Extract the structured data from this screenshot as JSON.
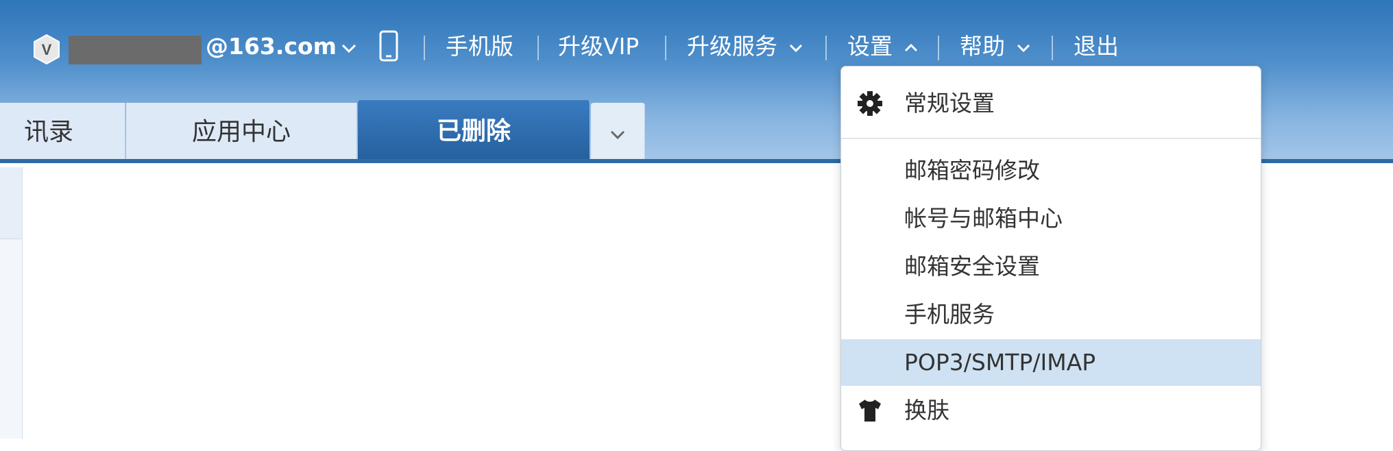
{
  "topbar": {
    "vip_badge_letter": "V",
    "email_suffix": "@163.com",
    "mobile_version": "手机版",
    "upgrade_vip": "升级VIP",
    "upgrade_service": "升级服务",
    "settings": "设置",
    "help": "帮助",
    "logout": "退出"
  },
  "tabs": [
    {
      "label": "讯录"
    },
    {
      "label": "应用中心"
    },
    {
      "label": "已删除",
      "active": true
    }
  ],
  "settings_menu": {
    "general": "常规设置",
    "items": [
      {
        "label": "邮箱密码修改"
      },
      {
        "label": "帐号与邮箱中心"
      },
      {
        "label": "邮箱安全设置"
      },
      {
        "label": "手机服务"
      },
      {
        "label": "POP3/SMTP/IMAP",
        "highlighted": true
      }
    ],
    "skin": "换肤"
  },
  "colors": {
    "header_top": "#2f75b9",
    "active_tab": "#255f9c",
    "menu_highlight": "#cfe2f3"
  }
}
